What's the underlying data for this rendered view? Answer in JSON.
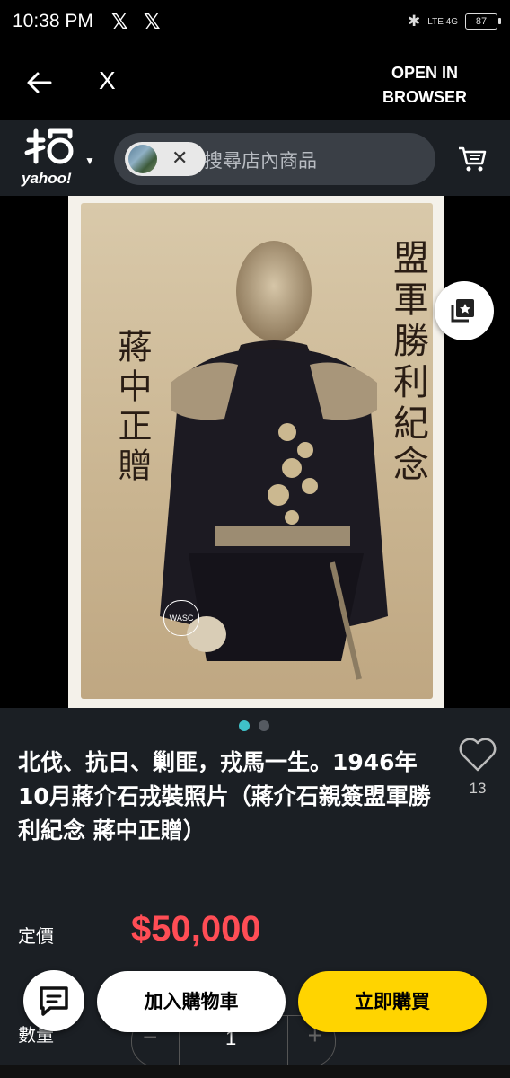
{
  "status": {
    "time": "10:38 PM",
    "notif_icon": "x-logo-icon",
    "network": "LTE 4G",
    "battery": "87"
  },
  "browser": {
    "close_label": "X",
    "open_in_browser": "OPEN IN BROWSER"
  },
  "header": {
    "logo_text": "yahoo!",
    "search_placeholder": "搜尋店內商品",
    "chip_close": "✕"
  },
  "image": {
    "stamp_text": "WASC",
    "calligraphy_left": "蔣中正贈",
    "calligraphy_right": "盟軍勝利紀念",
    "page_count": 2,
    "active_page": 1
  },
  "product": {
    "title": "北伐、抗日、剿匪，戎馬一生。1946年10月蔣介石戎裝照片（蔣介石親簽盟軍勝利紀念 蔣中正贈）",
    "likes": "13",
    "price_label": "定價",
    "price": "$50,000",
    "qty_label": "數量",
    "qty_value": "1",
    "minus": "−",
    "plus": "+"
  },
  "actions": {
    "add_to_cart": "加入購物車",
    "buy_now": "立即購買"
  },
  "colors": {
    "price": "#ff4d55",
    "buy_button": "#ffd400",
    "active_dot": "#3fc1c9"
  }
}
